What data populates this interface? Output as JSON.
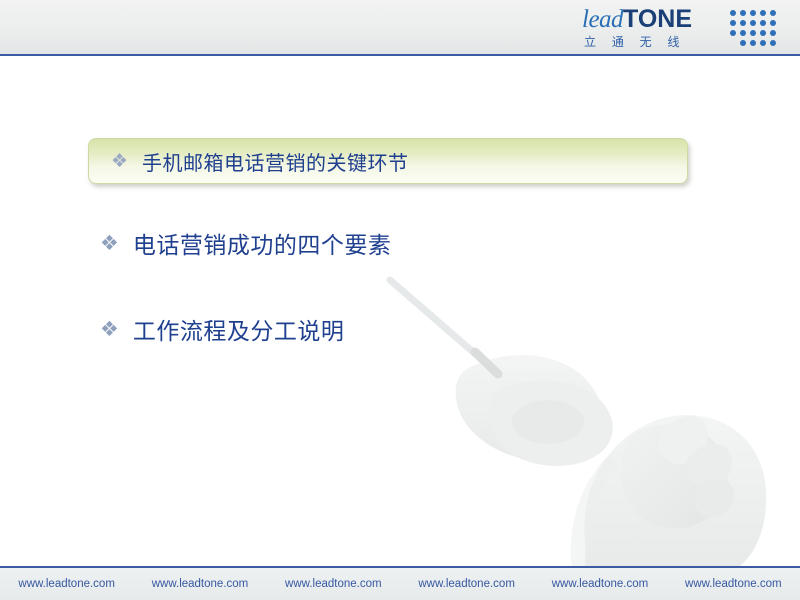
{
  "header": {
    "logo_lead": "lead",
    "logo_tone": "TONE",
    "logo_cn": "立 通 无 线",
    "accent_color": "#3b5ba5"
  },
  "content": {
    "bullets": [
      {
        "marker": "❖",
        "text": "手机邮箱电话营销的关键环节",
        "highlighted": true
      },
      {
        "marker": "❖",
        "text": "电话营销成功的四个要素",
        "highlighted": false
      },
      {
        "marker": "❖",
        "text": "工作流程及分工说明",
        "highlighted": false
      }
    ]
  },
  "footer": {
    "links": [
      "www.leadtone.com",
      "www.leadtone.com",
      "www.leadtone.com",
      "www.leadtone.com",
      "www.leadtone.com",
      "www.leadtone.com"
    ]
  }
}
